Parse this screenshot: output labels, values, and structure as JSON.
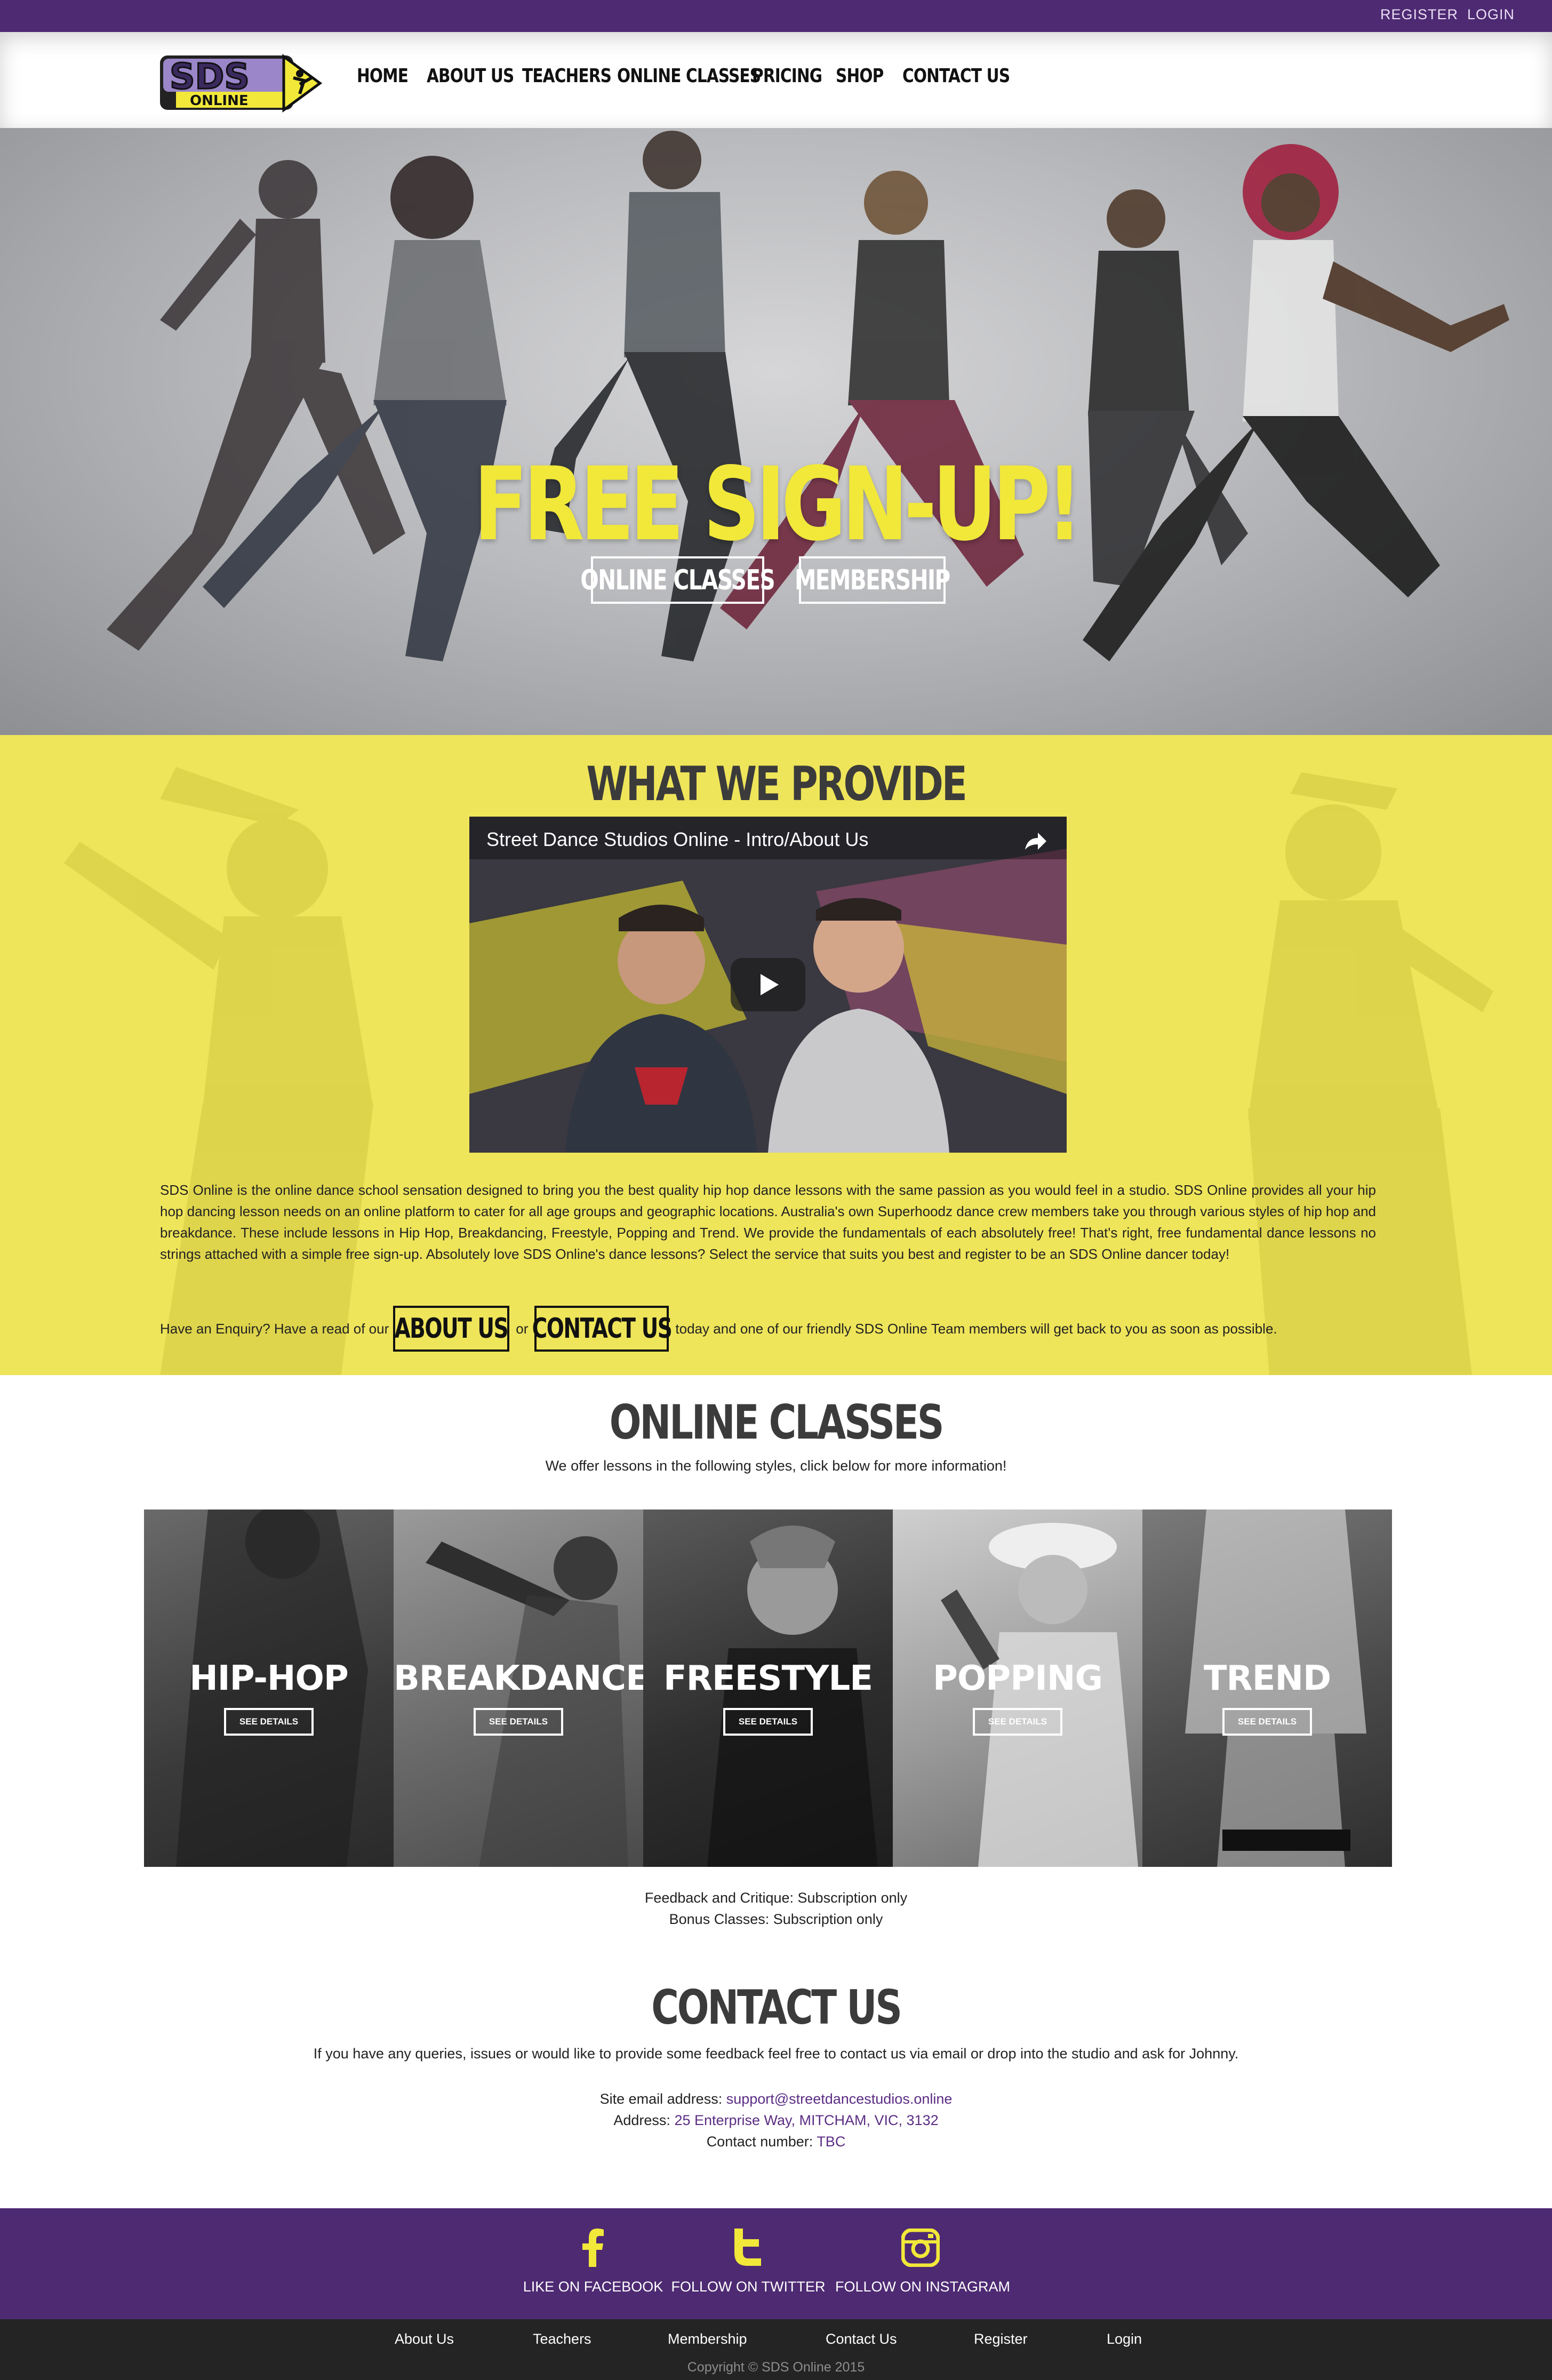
{
  "topbar": {
    "register": "REGISTER",
    "login": "LOGIN"
  },
  "logo": {
    "text_top": "SDS",
    "text_bottom": "ONLINE"
  },
  "nav": [
    "HOME",
    "ABOUT US",
    "TEACHERS",
    "ONLINE CLASSES",
    "PRICING",
    "SHOP",
    "CONTACT US"
  ],
  "hero": {
    "title": "FREE SIGN-UP!",
    "btn_classes": "ONLINE CLASSES",
    "btn_membership": "MEMBERSHIP"
  },
  "provide": {
    "title": "WHAT WE PROVIDE",
    "video_title": "Street Dance Studios Online - Intro/About Us",
    "body": "SDS Online is the online dance school sensation designed to bring you the best quality hip hop dance lessons with the same passion as you would feel in a studio. SDS Online provides all your hip hop dancing lesson needs on an online platform to cater for all age groups and geographic locations. Australia's own Superhoodz dance crew members take you through various styles of hip hop and breakdance. These include lessons in Hip Hop, Breakdancing, Freestyle, Popping and Trend. We provide the fundamentals of each absolutely free! That's right, free fundamental dance lessons no strings attached with a simple free sign-up. Absolutely love SDS Online's dance lessons? Select the service that suits you best and register to be an SDS Online dancer today!",
    "enquiry_pre": "Have an Enquiry? Have a read of our",
    "enquiry_about": "ABOUT US",
    "enquiry_or": "or",
    "enquiry_contact": "CONTACT US",
    "enquiry_post": "today and one of our friendly SDS Online Team members will get back to you as soon as possible."
  },
  "classes": {
    "title": "ONLINE CLASSES",
    "subtitle": "We offer lessons in the following styles, click below for more information!",
    "styles": [
      {
        "name": "HIP-HOP",
        "button": "SEE DETAILS"
      },
      {
        "name": "BREAKDANCE",
        "button": "SEE DETAILS"
      },
      {
        "name": "FREESTYLE",
        "button": "SEE DETAILS"
      },
      {
        "name": "POPPING",
        "button": "SEE DETAILS"
      },
      {
        "name": "TREND",
        "button": "SEE DETAILS"
      }
    ],
    "feedback_line": "Feedback and Critique: Subscription only",
    "bonus_line": "Bonus Classes: Subscription only"
  },
  "contact": {
    "title": "CONTACT US",
    "intro": "If you have any queries, issues or would like to provide some feedback feel free to contact us via email or drop into the studio and ask for Johnny.",
    "email_label": "Site email address:",
    "email": "support@streetdancestudios.online",
    "address_label": "Address:",
    "address": "25 Enterprise Way, MITCHAM, VIC, 3132",
    "phone_label": "Contact number:",
    "phone": "TBC"
  },
  "social": {
    "facebook": "LIKE ON FACEBOOK",
    "twitter": "FOLLOW ON TWITTER",
    "instagram": "FOLLOW ON INSTAGRAM"
  },
  "footer": {
    "links": [
      "About Us",
      "Teachers",
      "Membership",
      "Contact Us",
      "Register",
      "Login"
    ],
    "copyright": "Copyright © SDS Online 2015"
  },
  "colors": {
    "purple": "#4e2a73",
    "yellow": "#efe55a",
    "hero_title": "#f1e83a"
  }
}
